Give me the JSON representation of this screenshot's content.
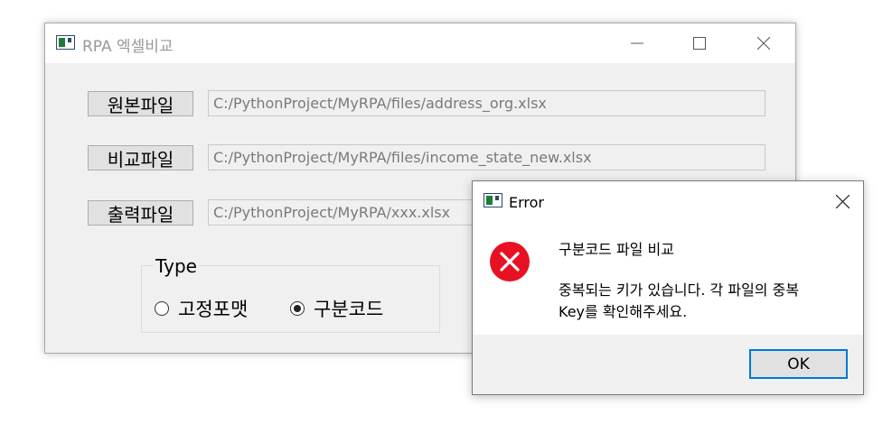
{
  "main_window": {
    "title": "RPA 엑셀비교",
    "rows": [
      {
        "button_label": "원본파일",
        "path": "C:/PythonProject/MyRPA/files/address_org.xlsx"
      },
      {
        "button_label": "비교파일",
        "path": "C:/PythonProject/MyRPA/files/income_state_new.xlsx"
      },
      {
        "button_label": "출력파일",
        "path": "C:/PythonProject/MyRPA/xxx.xlsx"
      }
    ],
    "type_group": {
      "label": "Type",
      "options": [
        {
          "label": "고정포맷",
          "selected": false
        },
        {
          "label": "구분코드",
          "selected": true
        }
      ]
    }
  },
  "error_dialog": {
    "title": "Error",
    "heading": "구분코드 파일 비교",
    "message_line1": "중복되는 키가 있습니다. 각 파일의 중복",
    "message_line2": "Key를 확인해주세요.",
    "ok_label": "OK"
  },
  "icons": [
    "app-icon",
    "minimize-icon",
    "maximize-icon",
    "close-icon",
    "error-icon"
  ],
  "colors": {
    "error_red": "#e81123",
    "focus_blue": "#0078d7"
  }
}
